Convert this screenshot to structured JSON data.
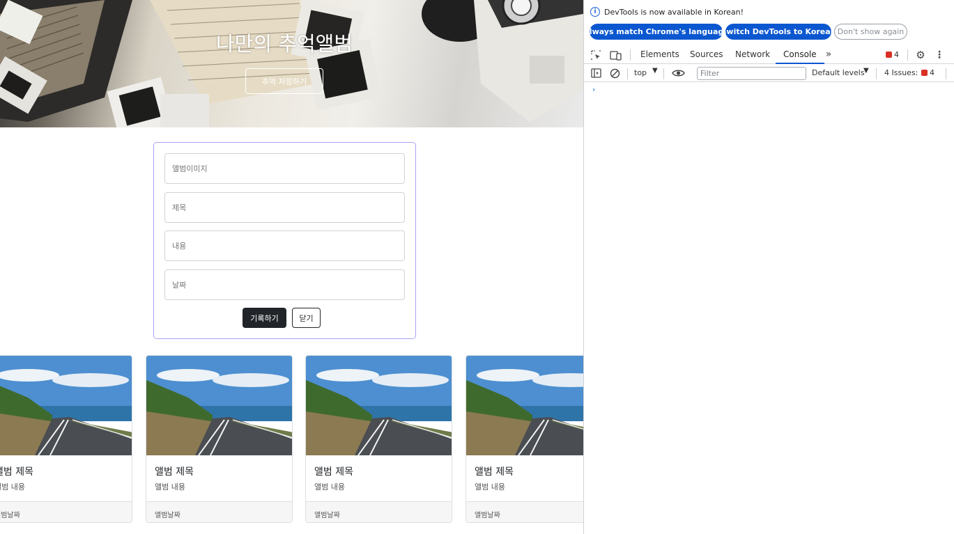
{
  "hero": {
    "title": "나만의 추억앨범",
    "button_label": "추억 저장하기"
  },
  "form": {
    "image_placeholder": "앨범이미지",
    "title_placeholder": "제목",
    "content_placeholder": "내용",
    "date_placeholder": "날짜",
    "submit_label": "기록하기",
    "close_label": "닫기"
  },
  "albums": [
    {
      "title": "앨범 제목",
      "text": "앨범 내용",
      "date": "앨범날짜"
    },
    {
      "title": "앨범 제목",
      "text": "앨범 내용",
      "date": "앨범날짜"
    },
    {
      "title": "앨범 제목",
      "text": "앨범 내용",
      "date": "앨범날짜"
    },
    {
      "title": "앨범 제목",
      "text": "앨범 내용",
      "date": "앨범날짜"
    }
  ],
  "devtools": {
    "info_message": "DevTools is now available in Korean!",
    "btn_match_language": "Always match Chrome's language",
    "btn_switch_korean": "Switch DevTools to Korean",
    "btn_dont_show": "Don't show again",
    "tabs": [
      "Elements",
      "Sources",
      "Network",
      "Console"
    ],
    "active_tab": "Console",
    "error_count": "4",
    "context": "top",
    "filter_placeholder": "Filter",
    "levels": "Default levels",
    "issues_label": "4 Issues:",
    "issues_count": "4",
    "accent_color": "#0b57d0",
    "error_color": "#d93025"
  }
}
